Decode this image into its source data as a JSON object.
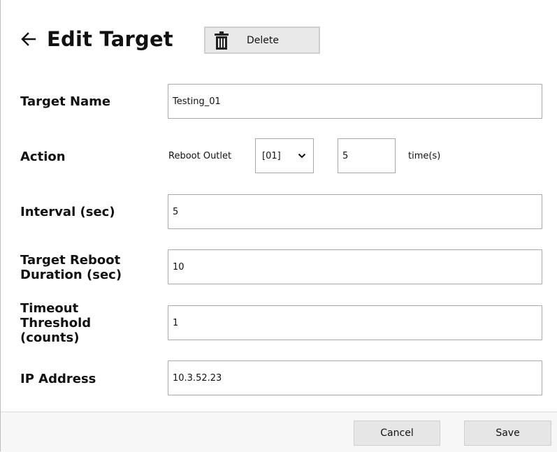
{
  "header": {
    "title": "Edit Target",
    "delete_label": "Delete"
  },
  "form": {
    "target_name": {
      "label": "Target Name",
      "value": "Testing_01"
    },
    "action": {
      "label": "Action",
      "reboot_label": "Reboot Outlet",
      "outlet_selected": "[01]",
      "count_value": "5",
      "times_label": "time(s)"
    },
    "interval": {
      "label": "Interval (sec)",
      "value": "5"
    },
    "reboot_duration": {
      "label_line1": "Target Reboot",
      "label_line2": "Duration (sec)",
      "value": "10"
    },
    "timeout_threshold": {
      "label_line1": "Timeout",
      "label_line2": "Threshold",
      "label_line3": "(counts)",
      "value": "1"
    },
    "ip_address": {
      "label": "IP Address",
      "value": "10.3.52.23"
    }
  },
  "footer": {
    "cancel_label": "Cancel",
    "save_label": "Save"
  },
  "icons": {
    "back": "arrow-left-icon",
    "delete": "trash-icon",
    "select": "chevron-down-icon"
  }
}
